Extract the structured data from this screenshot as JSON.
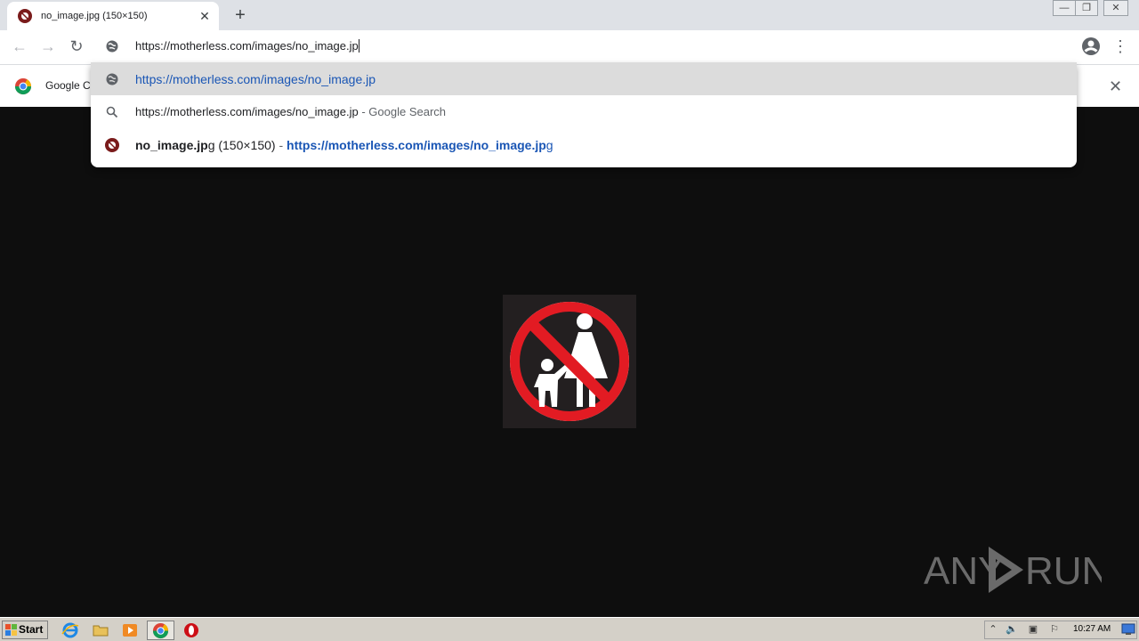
{
  "tab": {
    "title": "no_image.jpg (150×150)",
    "close_icon": "close-icon",
    "new_tab_icon": "plus-icon"
  },
  "window_controls": {
    "minimize": "minimize-icon",
    "restore": "restore-icon",
    "close": "close-icon"
  },
  "omnibox": {
    "value": "https://motherless.com/images/no_image.jp",
    "icon": "globe-icon"
  },
  "infobar": {
    "text": "Google Cl",
    "close_icon": "close-icon"
  },
  "suggestions": [
    {
      "icon": "globe-icon",
      "url": "https://motherless.com/images/no_image.jp",
      "selected": true
    },
    {
      "icon": "search-icon",
      "query": "https://motherless.com/images/no_image.jp",
      "suffix": " - Google Search"
    },
    {
      "icon": "site-favicon",
      "title_bold": "no_image.jp",
      "title_rest": "g (150×150)",
      "separator": " - ",
      "url_bold": "https://motherless.com/images/no_image.jp",
      "url_rest": "g"
    }
  ],
  "watermark": {
    "left": "ANY",
    "right": "RUN"
  },
  "taskbar": {
    "start_label": "Start",
    "clock": "10:27 AM"
  },
  "colors": {
    "link_blue": "#1a56b5",
    "page_bg": "#0e0e0e",
    "sign_red": "#e21b23"
  }
}
